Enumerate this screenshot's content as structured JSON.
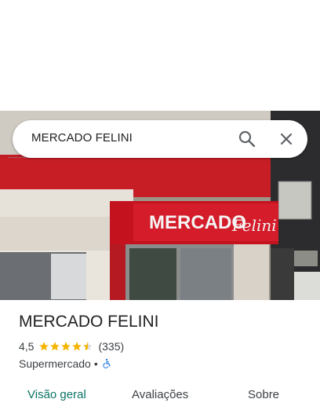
{
  "search": {
    "query": "MERCADO FELINI"
  },
  "store_sign": {
    "brand": "MERCADO",
    "script": "Felini"
  },
  "place": {
    "name": "MERCADO FELINI",
    "rating": "4,5",
    "stars_value": 4.5,
    "reviews_count": "(335)",
    "category": "Supermercado",
    "separator": "•"
  },
  "tabs": [
    {
      "label": "Visão geral",
      "active": true
    },
    {
      "label": "Avaliações",
      "active": false
    },
    {
      "label": "Sobre",
      "active": false
    }
  ],
  "colors": {
    "star": "#f4b400",
    "active_tab": "#0b7466",
    "accessibility_icon": "#1a73e8",
    "sign_red": "#c8102e"
  },
  "icons": [
    "search-icon",
    "close-icon",
    "star-icon",
    "wheelchair-icon"
  ]
}
